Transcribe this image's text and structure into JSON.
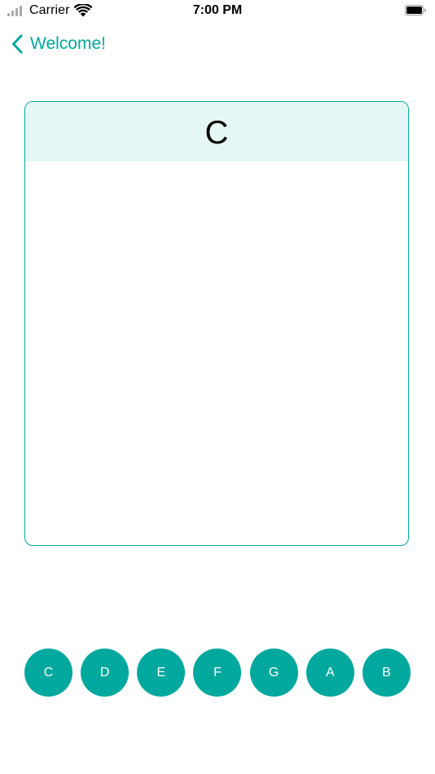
{
  "status_bar": {
    "carrier": "Carrier",
    "time": "7:00 PM",
    "signal_icon": "signal-bars-icon",
    "wifi_icon": "wifi-icon",
    "battery_icon": "battery-icon"
  },
  "nav": {
    "back_label": "Welcome!",
    "back_icon": "chevron-left-icon"
  },
  "card": {
    "title": "C"
  },
  "notes": [
    "C",
    "D",
    "E",
    "F",
    "G",
    "A",
    "B"
  ],
  "colors": {
    "accent": "#00a89d",
    "header_bg": "#e5f6f4",
    "text": "#000000",
    "button_text": "#ffffff"
  }
}
